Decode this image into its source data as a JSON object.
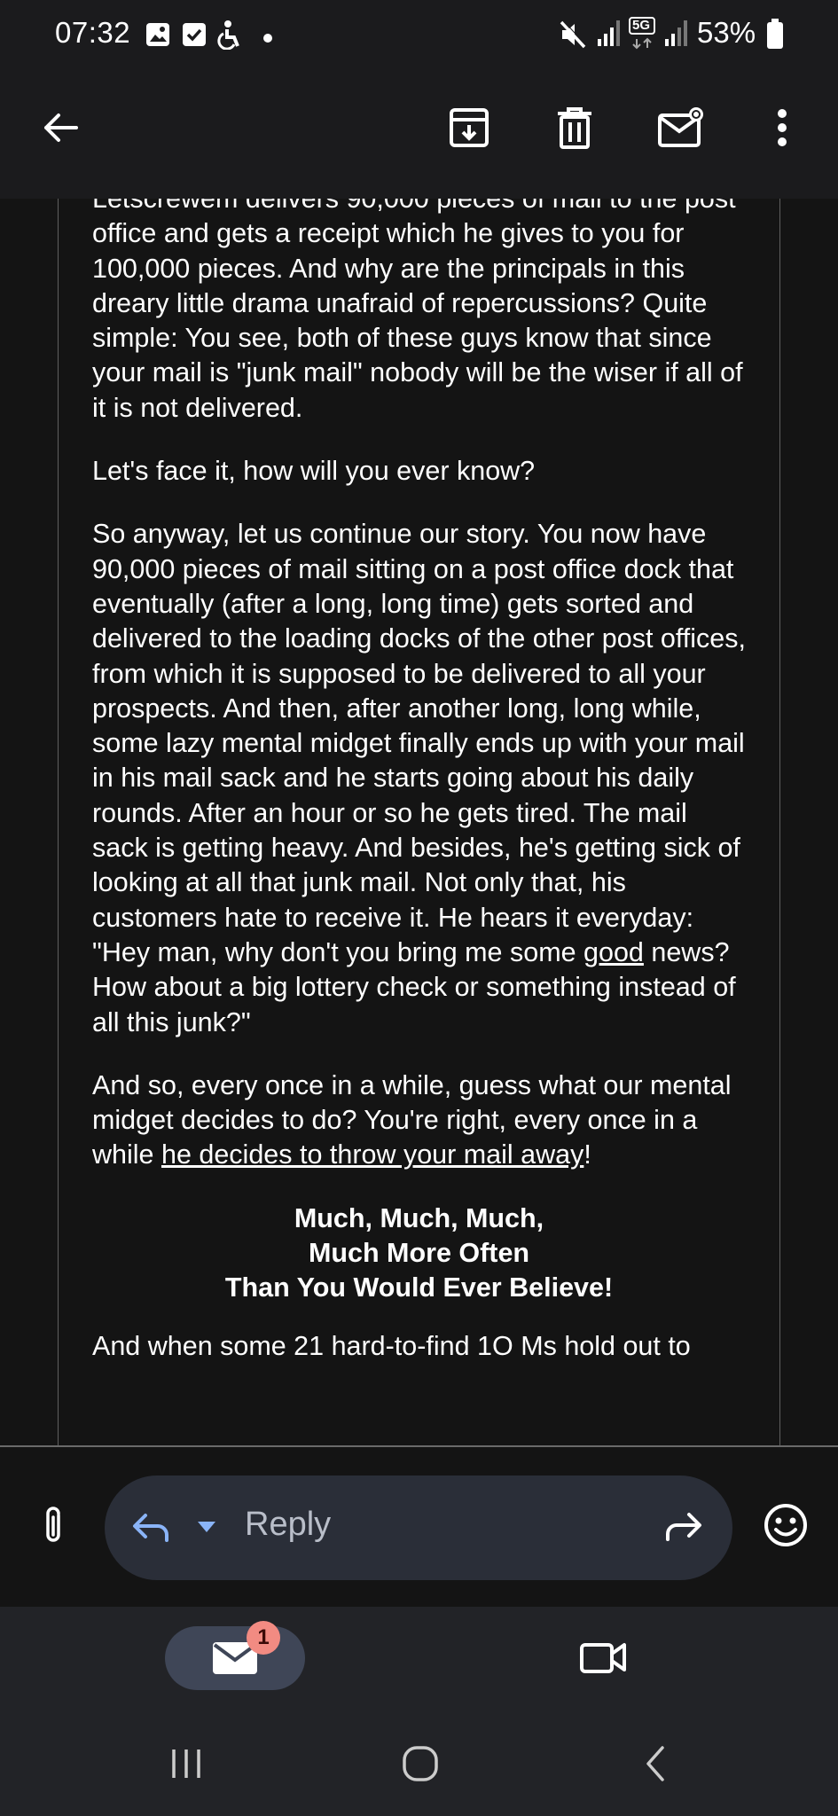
{
  "status_bar": {
    "time": "07:32",
    "network": "5G",
    "battery": "53%",
    "icons": [
      "gallery-icon",
      "checkbox-icon",
      "accessibility-icon",
      "dot-icon",
      "mute-icon",
      "signal-icon",
      "signal-icon",
      "battery-icon"
    ]
  },
  "toolbar": {
    "icons": [
      "back-arrow-icon",
      "archive-icon",
      "delete-icon",
      "mark-unread-icon",
      "more-options-icon"
    ]
  },
  "email": {
    "cut_top_line": "Letscrewem delivers 90,000 pieces of mail to the",
    "paragraph_1_rest": "post office and gets a receipt which he gives to you for 100,000 pieces. And why are the principals in this dreary little drama unafraid of repercussions? Quite simple: You see, both of these guys know that since your mail is \"junk mail\" nobody will be the wiser if all of it is not delivered.",
    "paragraph_2": "Let's face it, how will you ever know?",
    "paragraph_3_a": "So anyway, let us continue our story. You now have 90,000 pieces of mail sitting on a post office dock that eventually (after a long, long time) gets sorted and delivered to the loading docks of the other post offices, from which it is supposed to be delivered to all your prospects. And then, after another long, long while, some lazy mental midget finally ends up with your mail in his mail sack and he starts going about his daily rounds. After an hour or so he gets tired. The mail sack is getting heavy. And besides, he's getting sick of looking at all that junk mail. Not only that, his customers hate to receive it. He hears it everyday: \"Hey man, why don't you bring me some ",
    "paragraph_3_underlined": "good",
    "paragraph_3_b": " news? How about a big lottery check or something instead of all this junk?\"",
    "paragraph_4_a": "And so, every once in a while, guess what our mental midget decides to do? You're right, every once in a while ",
    "paragraph_4_underlined": "he decides to throw your mail away",
    "paragraph_4_b": "!",
    "closing_1": "Much, Much, Much,",
    "closing_2": "Much More Often",
    "closing_3": "Than You Would Ever Believe!",
    "cut_bottom_line": "And when some 21 hard-to-find 1O Ms hold out to"
  },
  "reply_bar": {
    "reply_label": "Reply",
    "icons": [
      "attachment-icon",
      "reply-icon",
      "dropdown-icon",
      "forward-icon",
      "emoji-icon"
    ]
  },
  "bottom_nav": {
    "mail_badge": "1",
    "icons": [
      "mail-icon",
      "meet-video-icon"
    ]
  },
  "system_nav": {
    "icons": [
      "recents-icon",
      "home-icon",
      "back-icon"
    ]
  },
  "colors": {
    "background": "#1b1b1d",
    "reply_pill": "#2a2e38",
    "mail_pill": "#3f4657",
    "badge": "#f28b82",
    "text": "#ffffff"
  }
}
